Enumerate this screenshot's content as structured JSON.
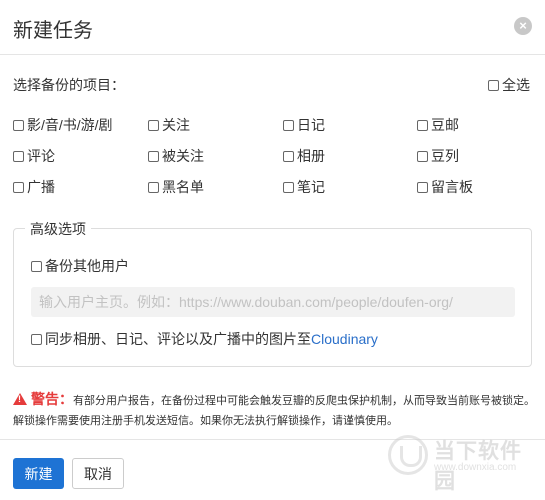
{
  "dialog": {
    "title": "新建任务",
    "close_symbol": "×"
  },
  "backup": {
    "label": "选择备份的项目：",
    "select_all": "全选",
    "items": [
      "影/音/书/游/剧",
      "关注",
      "日记",
      "豆邮",
      "评论",
      "被关注",
      "相册",
      "豆列",
      "广播",
      "黑名单",
      "笔记",
      "留言板"
    ]
  },
  "advanced": {
    "legend": "高级选项",
    "backup_other_users": "备份其他用户",
    "url_placeholder": "输入用户主页。例如：https://www.douban.com/people/doufen-org/",
    "sync_images_prefix": "同步相册、日记、评论以及广播中的图片至 ",
    "sync_images_link": "Cloudinary"
  },
  "warning": {
    "title": "警告：",
    "text": "有部分用户报告，在备份过程中可能会触发豆瓣的反爬虫保护机制，从而导致当前账号被锁定。解锁操作需要使用注册手机发送短信。如果你无法执行解锁操作，请谨慎使用。"
  },
  "footer": {
    "create_label": "新建",
    "cancel_label": "取消"
  },
  "watermark": {
    "text": "当下软件园",
    "url": "www.downxia.com"
  },
  "colors": {
    "primary": "#1e73d4",
    "warning": "#e53b3b",
    "link": "#2a6fc9"
  }
}
